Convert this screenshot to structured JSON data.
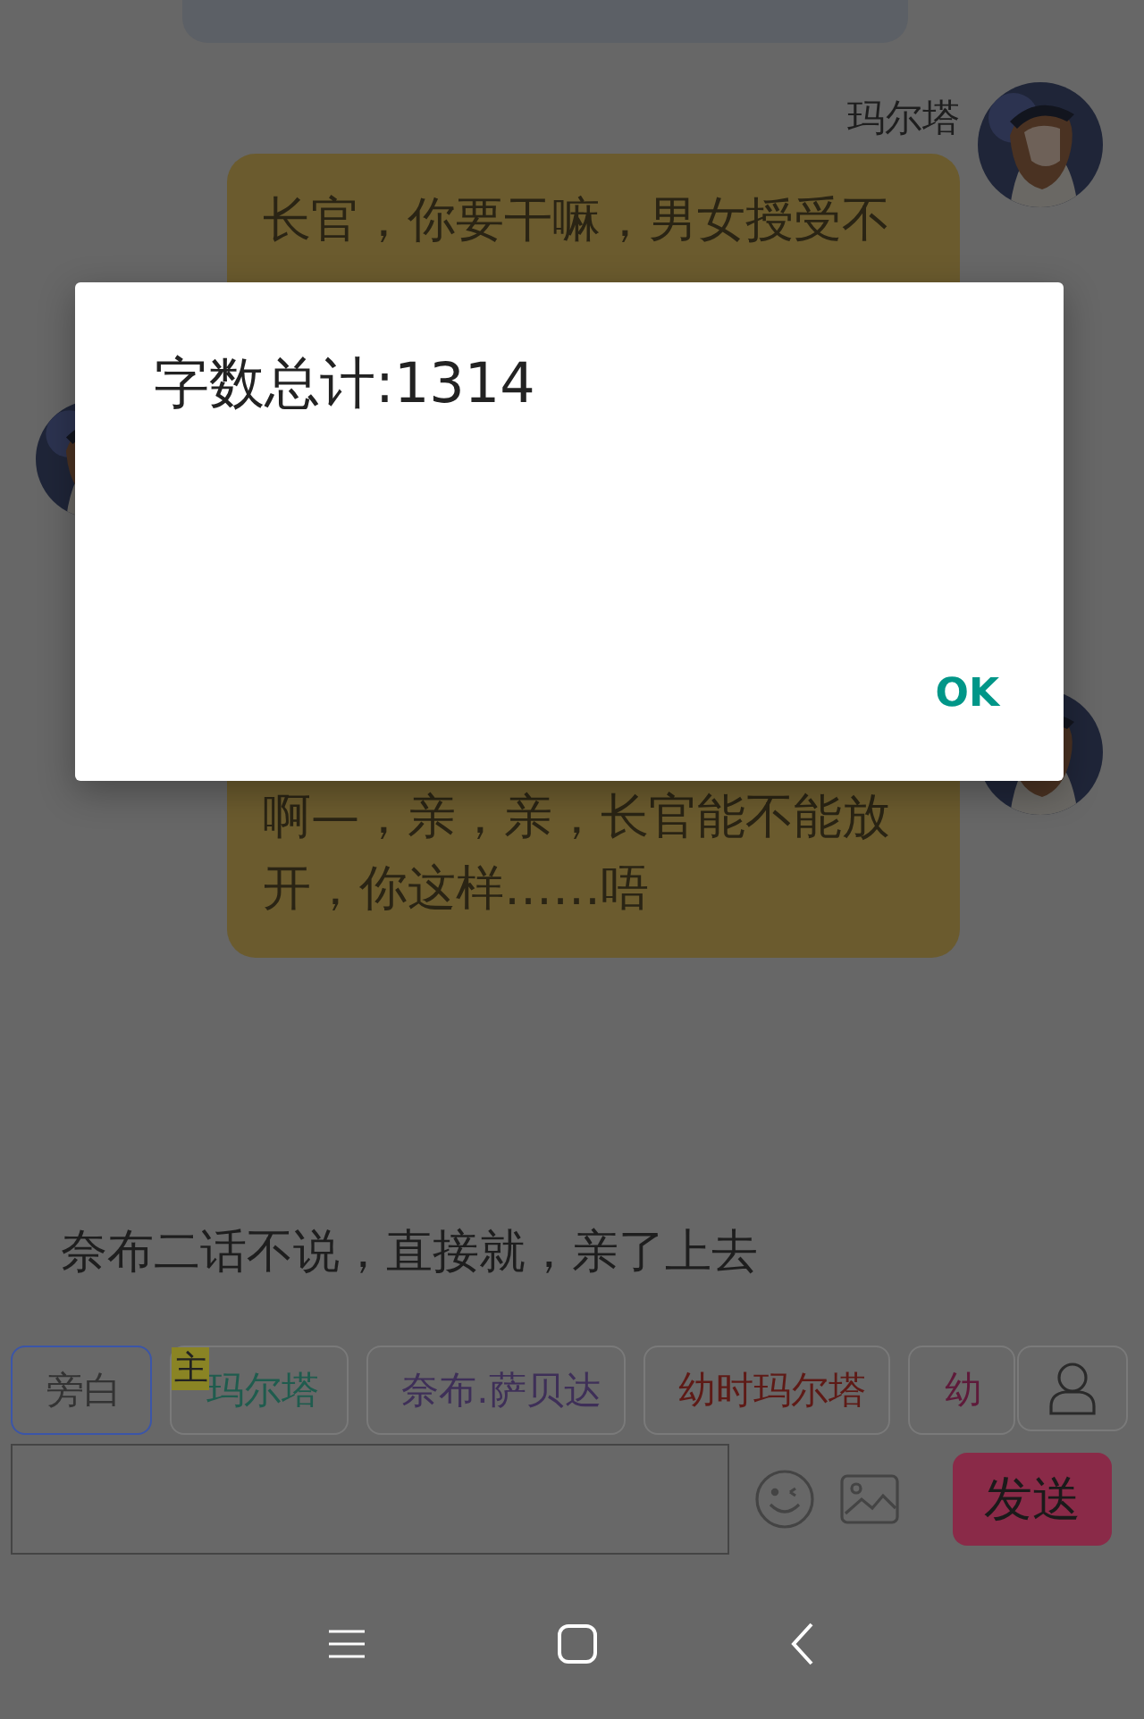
{
  "messages": [
    {
      "kind": "cut_bubble"
    },
    {
      "kind": "right_bubble",
      "name": "玛尔塔",
      "text": "长官，你要干嘛，男女授受不"
    },
    {
      "kind": "left_avatar"
    },
    {
      "kind": "right_bubble",
      "text": "啊—，亲，亲，长官能不能放开，你这样……唔"
    }
  ],
  "narration": "奈布二话不说，直接就，亲了上去",
  "roles": [
    {
      "label": "旁白",
      "selected": true,
      "color": "#333333"
    },
    {
      "label": "玛尔塔",
      "selected": false,
      "color": "#1f5c4e",
      "badge": "主"
    },
    {
      "label": "奈布.萨贝达",
      "selected": false,
      "color": "#3e2f58"
    },
    {
      "label": "幼时玛尔塔",
      "selected": false,
      "color": "#5e1a16"
    },
    {
      "label": "幼",
      "selected": false,
      "color": "#5e1a3a"
    }
  ],
  "composer": {
    "send": "发送"
  },
  "dialog": {
    "message": "字数总计:1314",
    "button": "OK"
  }
}
